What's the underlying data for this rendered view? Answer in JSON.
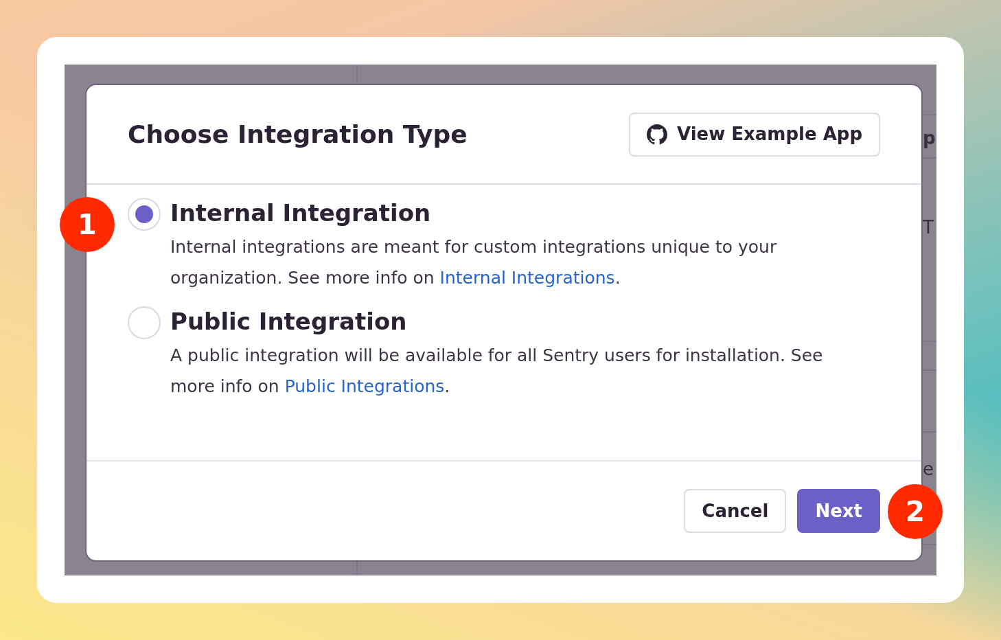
{
  "backdrop": {
    "fragments": [
      {
        "text": "p"
      },
      {
        "text": "T"
      },
      {
        "text": "e"
      }
    ]
  },
  "modal": {
    "title": "Choose Integration Type",
    "example_button": "View Example App",
    "options": [
      {
        "title": "Internal Integration",
        "description": "Internal integrations are meant for custom integrations unique to your organization. See more info on ",
        "link": "Internal Integrations",
        "after": ".",
        "selected": true
      },
      {
        "title": "Public Integration",
        "description": "A public integration will be available for all Sentry users for installation. See more info on ",
        "link": "Public Integrations",
        "after": ".",
        "selected": false
      }
    ],
    "buttons": [
      {
        "label": "Cancel",
        "kind": "secondary"
      },
      {
        "label": "Next",
        "kind": "primary"
      }
    ]
  },
  "callouts": [
    {
      "label": "1"
    },
    {
      "label": "2"
    }
  ]
}
